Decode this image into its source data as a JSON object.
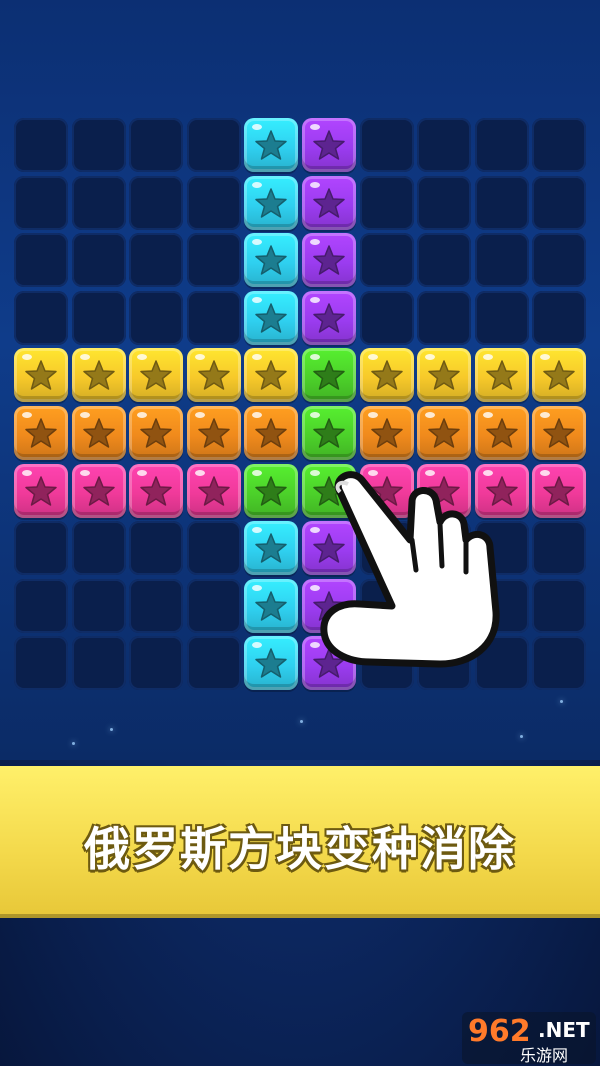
{
  "banner": {
    "title": "俄罗斯方块变种消除"
  },
  "watermark": {
    "number": "962",
    "suffix": ".NET",
    "subtitle": "乐游网"
  },
  "board": {
    "rows": 10,
    "cols": 10,
    "colors": {
      "cyan": "#2fd0f0",
      "purple": "#9b3cf0",
      "yellow": "#f7c92a",
      "orange": "#f08a1c",
      "pink": "#f03a9a",
      "green": "#4cd12a",
      "empty": "#0a1f4c"
    },
    "grid": [
      [
        "empty",
        "empty",
        "empty",
        "empty",
        "cyan",
        "purple",
        "empty",
        "empty",
        "empty",
        "empty"
      ],
      [
        "empty",
        "empty",
        "empty",
        "empty",
        "cyan",
        "purple",
        "empty",
        "empty",
        "empty",
        "empty"
      ],
      [
        "empty",
        "empty",
        "empty",
        "empty",
        "cyan",
        "purple",
        "empty",
        "empty",
        "empty",
        "empty"
      ],
      [
        "empty",
        "empty",
        "empty",
        "empty",
        "cyan",
        "purple",
        "empty",
        "empty",
        "empty",
        "empty"
      ],
      [
        "yellow",
        "yellow",
        "yellow",
        "yellow",
        "yellow",
        "green",
        "yellow",
        "yellow",
        "yellow",
        "yellow"
      ],
      [
        "orange",
        "orange",
        "orange",
        "orange",
        "orange",
        "green",
        "orange",
        "orange",
        "orange",
        "orange"
      ],
      [
        "pink",
        "pink",
        "pink",
        "pink",
        "green",
        "green",
        "pink",
        "pink",
        "pink",
        "pink"
      ],
      [
        "empty",
        "empty",
        "empty",
        "empty",
        "cyan",
        "purple",
        "empty",
        "empty",
        "empty",
        "empty"
      ],
      [
        "empty",
        "empty",
        "empty",
        "empty",
        "cyan",
        "purple",
        "empty",
        "empty",
        "empty",
        "empty"
      ],
      [
        "empty",
        "empty",
        "empty",
        "empty",
        "cyan",
        "purple",
        "empty",
        "empty",
        "empty",
        "empty"
      ]
    ]
  },
  "icons": {
    "hand": "pointing-hand-icon",
    "star": "star-icon"
  }
}
